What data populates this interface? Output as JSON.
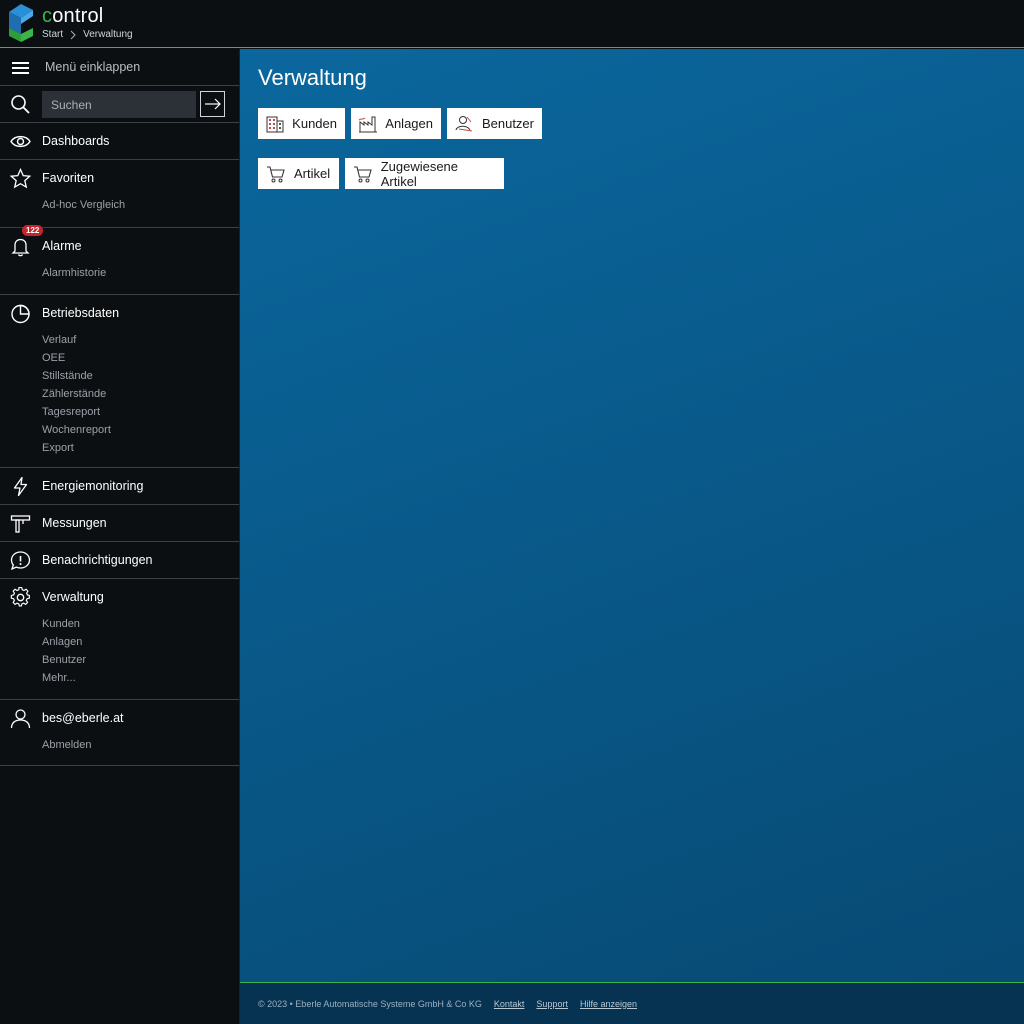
{
  "header": {
    "title_first": "c",
    "title_rest": "ontrol",
    "breadcrumb": [
      "Start",
      "Verwaltung"
    ]
  },
  "sidebar": {
    "collapse_label": "Menü einklappen",
    "search": {
      "placeholder": "Suchen"
    },
    "sections": {
      "dashboards": {
        "label": "Dashboards"
      },
      "favoriten": {
        "label": "Favoriten",
        "items": [
          "Ad-hoc Vergleich"
        ]
      },
      "alarme": {
        "label": "Alarme",
        "badge": "122",
        "items": [
          "Alarmhistorie"
        ]
      },
      "betriebsdaten": {
        "label": "Betriebsdaten",
        "items": [
          "Verlauf",
          "OEE",
          "Stillstände",
          "Zählerstände",
          "Tagesreport",
          "Wochenreport",
          "Export"
        ]
      },
      "energiemonitoring": {
        "label": "Energiemonitoring"
      },
      "messungen": {
        "label": "Messungen"
      },
      "benachrichtigungen": {
        "label": "Benachrichtigungen"
      },
      "verwaltung": {
        "label": "Verwaltung",
        "items": [
          "Kunden",
          "Anlagen",
          "Benutzer",
          "Mehr..."
        ]
      },
      "user": {
        "label": "bes@eberle.at",
        "items": [
          "Abmelden"
        ]
      }
    }
  },
  "main": {
    "title": "Verwaltung",
    "tiles": [
      "Kunden",
      "Anlagen",
      "Benutzer",
      "Artikel",
      "Zugewiesene Artikel"
    ]
  },
  "footer": {
    "copyright": "© 2023 • Eberle Automatische Systeme GmbH & Co KG",
    "links": [
      "Kontakt",
      "Support",
      "Hilfe anzeigen"
    ]
  },
  "colors": {
    "accent": "#39b54a",
    "sidebar_bg": "#0c0f12",
    "main_bg": "#0a679d",
    "badge": "#c8242b"
  }
}
